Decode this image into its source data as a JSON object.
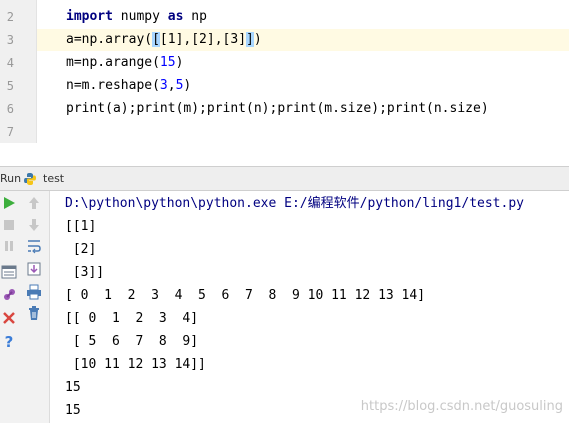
{
  "editor": {
    "line_numbers": [
      "2",
      "3",
      "4",
      "5",
      "6",
      "7"
    ],
    "lines": {
      "l2": {
        "kw1": "import",
        "a": " numpy ",
        "kw2": "as",
        "b": " np"
      },
      "l3": {
        "a": "a=np.array(",
        "b1": "[",
        "c": "[1],[2],[3]",
        "b2": "]",
        "d": ")"
      },
      "l4": {
        "a": "m=np.arange(",
        "n": "15",
        "b": ")"
      },
      "l5": {
        "a": "n=m.reshape(",
        "n1": "3",
        "c": ",",
        "n2": "5",
        "b": ")"
      },
      "l6": {
        "a": "print(a);print(m);print(n);print(m.size);print(n.size)"
      }
    }
  },
  "run_panel": {
    "label": "Run",
    "tab": "test",
    "command": "D:\\python\\python\\python.exe E:/编程软件/python/ling1/test.py",
    "output": [
      "[[1]",
      " [2]",
      " [3]]",
      "[ 0  1  2  3  4  5  6  7  8  9 10 11 12 13 14]",
      "[[ 0  1  2  3  4]",
      " [ 5  6  7  8  9]",
      " [10 11 12 13 14]]",
      "15",
      "15"
    ]
  },
  "toolbar_icons": [
    "rerun-icon",
    "stop-icon",
    "pause-icon",
    "restore-layout-icon",
    "pin-icon",
    "close-icon",
    "help-icon",
    "up-arrow-icon",
    "down-arrow-icon",
    "soft-wrap-icon",
    "scroll-to-end-icon",
    "print-icon",
    "trash-icon"
  ],
  "watermark": "https://blog.csdn.net/guosuling",
  "colors": {
    "keyword": "#000080",
    "number": "#0000ff",
    "current_line": "#fffae3",
    "gutter": "#f0f0f0"
  }
}
